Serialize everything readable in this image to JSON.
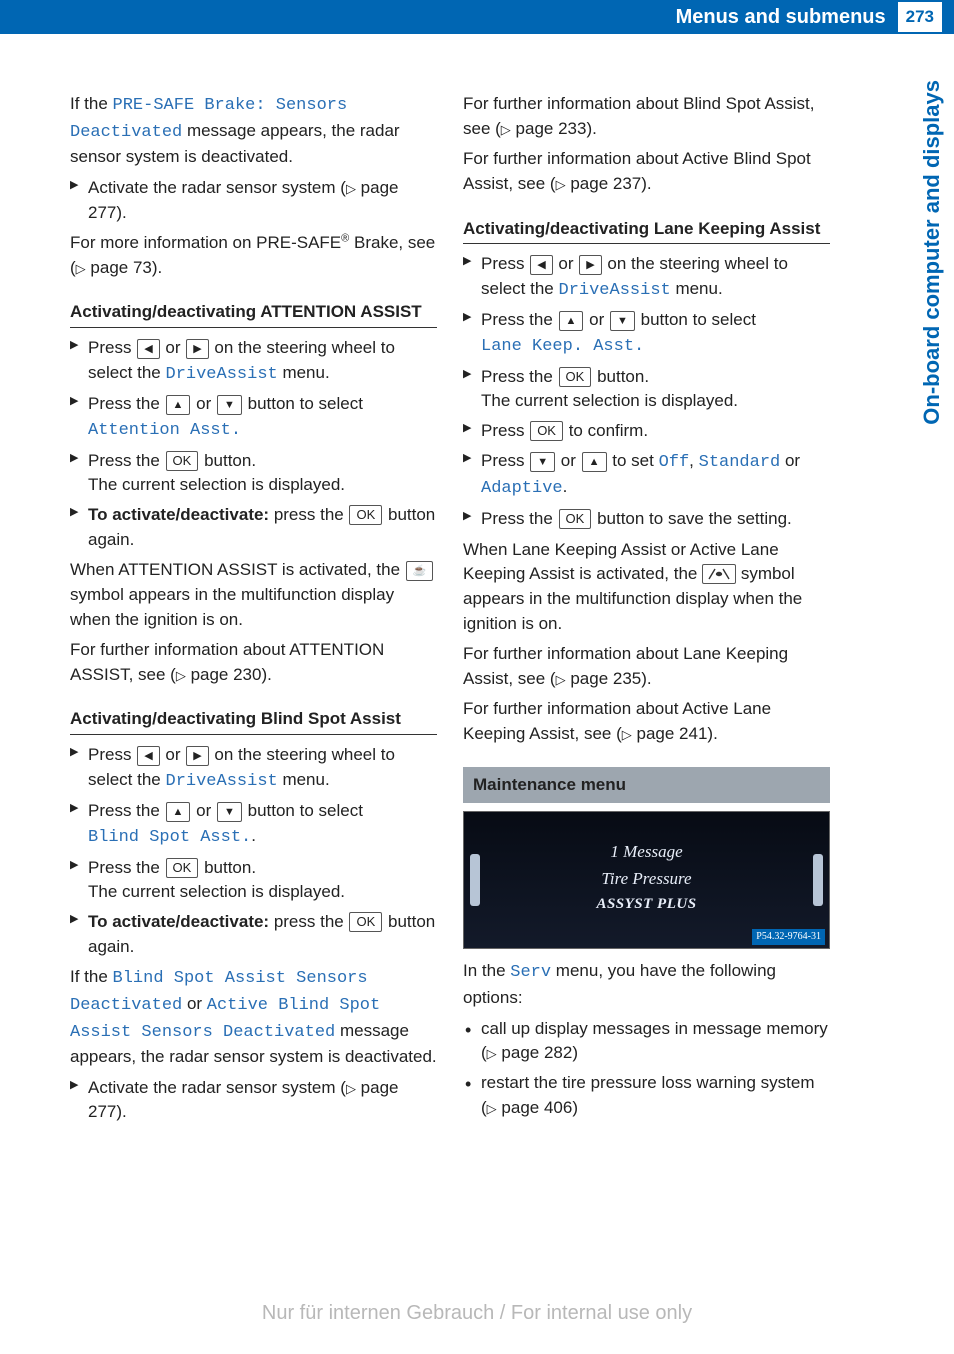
{
  "header": {
    "title": "Menus and submenus",
    "page_number": "273"
  },
  "side_tab": "On-board computer and displays",
  "col1": {
    "intro_pre": "If the ",
    "intro_disp": "PRE-SAFE Brake: Sensors Deactivated",
    "intro_post": " message appears, the radar sensor system is deactivated.",
    "activate_radar_pre": "Activate the radar sensor system (",
    "activate_radar_ref": "page 277",
    "activate_radar_post": ").",
    "presafe_more_pre": "For more information on PRE-SAFE",
    "presafe_more_mid": " Brake, see (",
    "presafe_more_ref": "page 73",
    "presafe_more_post": ").",
    "attn_heading": "Activating/deactivating ATTENTION ASSIST",
    "attn_s1_pre": "Press ",
    "attn_s1_mid": " or ",
    "attn_s1_post": " on the steering wheel to select the ",
    "attn_s1_disp": "DriveAssist",
    "attn_s1_end": " menu.",
    "attn_s2_pre": "Press the ",
    "attn_s2_mid": " or ",
    "attn_s2_post": " button to select ",
    "attn_s2_disp": "Attention Asst.",
    "attn_s3_pre": "Press the ",
    "attn_s3_post": " button.",
    "attn_s3_result": "The current selection is displayed.",
    "attn_s4_bold": "To activate/deactivate:",
    "attn_s4_pre": " press the ",
    "attn_s4_post": " button again.",
    "attn_active_pre": "When ATTENTION ASSIST is activated, the ",
    "attn_active_post": " symbol appears in the multifunction display when the ignition is on.",
    "attn_info_pre": "For further information about ATTENTION ASSIST, see (",
    "attn_info_ref": "page 230",
    "attn_info_post": ").",
    "bsa_heading": "Activating/deactivating Blind Spot Assist",
    "bsa_s1_pre": "Press ",
    "bsa_s1_mid": " or ",
    "bsa_s1_post": " on the steering wheel to select the ",
    "bsa_s1_disp": "DriveAssist",
    "bsa_s1_end": " menu.",
    "bsa_s2_pre": "Press the ",
    "bsa_s2_mid": " or ",
    "bsa_s2_post": " button to select ",
    "bsa_s2_disp": "Blind Spot Asst.",
    "bsa_s2_dot": ".",
    "bsa_s3_pre": "Press the ",
    "bsa_s3_post": " button.",
    "bsa_s3_result": "The current selection is displayed.",
    "bsa_s4_bold": "To activate/deactivate:",
    "bsa_s4_pre": " press the ",
    "bsa_s4_post": " button again.",
    "bsa_deact_pre": "If the ",
    "bsa_deact_d1": "Blind Spot Assist Sensors Deactivated",
    "bsa_deact_or": " or ",
    "bsa_deact_d2": "Active Blind Spot Assist Sensors Deactivated",
    "bsa_deact_post": " message appears, the radar sensor system is deactivated.",
    "bsa_radar_pre": "Activate the radar sensor system (",
    "bsa_radar_ref": "page 277",
    "bsa_radar_post": ")."
  },
  "col2": {
    "bsa_info_pre": "For further information about Blind Spot Assist, see (",
    "bsa_info_ref": "page 233",
    "bsa_info_post": ").",
    "absa_info_pre": "For further information about Active Blind Spot Assist, see (",
    "absa_info_ref": "page 237",
    "absa_info_post": ").",
    "lka_heading": "Activating/deactivating Lane Keeping Assist",
    "lka_s1_pre": "Press ",
    "lka_s1_mid": " or ",
    "lka_s1_post": " on the steering wheel to select the ",
    "lka_s1_disp": "DriveAssist",
    "lka_s1_end": " menu.",
    "lka_s2_pre": "Press the ",
    "lka_s2_mid": " or ",
    "lka_s2_post": " button to select ",
    "lka_s2_disp": "Lane Keep. Asst.",
    "lka_s3_pre": "Press the ",
    "lka_s3_post": " button.",
    "lka_s3_result": "The current selection is displayed.",
    "lka_s4_pre": "Press ",
    "lka_s4_post": " to confirm.",
    "lka_s5_pre": "Press ",
    "lka_s5_mid": " or ",
    "lka_s5_post": " to set ",
    "lka_s5_d1": "Off",
    "lka_s5_c1": ", ",
    "lka_s5_d2": "Standard",
    "lka_s5_or": " or ",
    "lka_s5_d3": "Adaptive",
    "lka_s5_dot": ".",
    "lka_s6_pre": "Press the ",
    "lka_s6_post": " button to save the setting.",
    "lka_active_pre": "When Lane Keeping Assist or Active Lane Keeping Assist is activated, the ",
    "lka_active_post": " symbol appears in the multifunction display when the ignition is on.",
    "lka_info_pre": "For further information about Lane Keeping Assist, see (",
    "lka_info_ref": "page 235",
    "lka_info_post": ").",
    "alka_info_pre": "For further information about Active Lane Keeping Assist, see (",
    "alka_info_ref": "page 241",
    "alka_info_post": ").",
    "maint_heading": "Maintenance menu",
    "display_l1": "1 Message",
    "display_l2": "Tire Pressure",
    "display_l3": "ASSYST PLUS",
    "display_tag": "P54.32-9764-31",
    "serv_pre": "In the ",
    "serv_disp": "Serv",
    "serv_post": " menu, you have the following options:",
    "serv_b1_pre": "call up display messages in message memory (",
    "serv_b1_ref": "page 282",
    "serv_b1_post": ")",
    "serv_b2_pre": "restart the tire pressure loss warning system (",
    "serv_b2_ref": "page 406",
    "serv_b2_post": ")"
  },
  "keys": {
    "ok": "OK"
  },
  "watermark": "Nur für internen Gebrauch / For internal use only"
}
